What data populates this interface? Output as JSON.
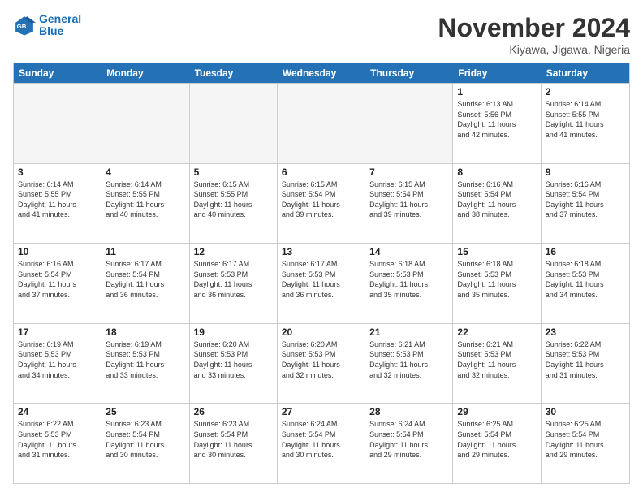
{
  "logo": {
    "line1": "General",
    "line2": "Blue"
  },
  "title": "November 2024",
  "location": "Kiyawa, Jigawa, Nigeria",
  "headers": [
    "Sunday",
    "Monday",
    "Tuesday",
    "Wednesday",
    "Thursday",
    "Friday",
    "Saturday"
  ],
  "weeks": [
    [
      {
        "day": "",
        "info": "",
        "empty": true
      },
      {
        "day": "",
        "info": "",
        "empty": true
      },
      {
        "day": "",
        "info": "",
        "empty": true
      },
      {
        "day": "",
        "info": "",
        "empty": true
      },
      {
        "day": "",
        "info": "",
        "empty": true
      },
      {
        "day": "1",
        "info": "Sunrise: 6:13 AM\nSunset: 5:56 PM\nDaylight: 11 hours\nand 42 minutes.",
        "empty": false
      },
      {
        "day": "2",
        "info": "Sunrise: 6:14 AM\nSunset: 5:55 PM\nDaylight: 11 hours\nand 41 minutes.",
        "empty": false
      }
    ],
    [
      {
        "day": "3",
        "info": "Sunrise: 6:14 AM\nSunset: 5:55 PM\nDaylight: 11 hours\nand 41 minutes.",
        "empty": false
      },
      {
        "day": "4",
        "info": "Sunrise: 6:14 AM\nSunset: 5:55 PM\nDaylight: 11 hours\nand 40 minutes.",
        "empty": false
      },
      {
        "day": "5",
        "info": "Sunrise: 6:15 AM\nSunset: 5:55 PM\nDaylight: 11 hours\nand 40 minutes.",
        "empty": false
      },
      {
        "day": "6",
        "info": "Sunrise: 6:15 AM\nSunset: 5:54 PM\nDaylight: 11 hours\nand 39 minutes.",
        "empty": false
      },
      {
        "day": "7",
        "info": "Sunrise: 6:15 AM\nSunset: 5:54 PM\nDaylight: 11 hours\nand 39 minutes.",
        "empty": false
      },
      {
        "day": "8",
        "info": "Sunrise: 6:16 AM\nSunset: 5:54 PM\nDaylight: 11 hours\nand 38 minutes.",
        "empty": false
      },
      {
        "day": "9",
        "info": "Sunrise: 6:16 AM\nSunset: 5:54 PM\nDaylight: 11 hours\nand 37 minutes.",
        "empty": false
      }
    ],
    [
      {
        "day": "10",
        "info": "Sunrise: 6:16 AM\nSunset: 5:54 PM\nDaylight: 11 hours\nand 37 minutes.",
        "empty": false
      },
      {
        "day": "11",
        "info": "Sunrise: 6:17 AM\nSunset: 5:54 PM\nDaylight: 11 hours\nand 36 minutes.",
        "empty": false
      },
      {
        "day": "12",
        "info": "Sunrise: 6:17 AM\nSunset: 5:53 PM\nDaylight: 11 hours\nand 36 minutes.",
        "empty": false
      },
      {
        "day": "13",
        "info": "Sunrise: 6:17 AM\nSunset: 5:53 PM\nDaylight: 11 hours\nand 36 minutes.",
        "empty": false
      },
      {
        "day": "14",
        "info": "Sunrise: 6:18 AM\nSunset: 5:53 PM\nDaylight: 11 hours\nand 35 minutes.",
        "empty": false
      },
      {
        "day": "15",
        "info": "Sunrise: 6:18 AM\nSunset: 5:53 PM\nDaylight: 11 hours\nand 35 minutes.",
        "empty": false
      },
      {
        "day": "16",
        "info": "Sunrise: 6:18 AM\nSunset: 5:53 PM\nDaylight: 11 hours\nand 34 minutes.",
        "empty": false
      }
    ],
    [
      {
        "day": "17",
        "info": "Sunrise: 6:19 AM\nSunset: 5:53 PM\nDaylight: 11 hours\nand 34 minutes.",
        "empty": false
      },
      {
        "day": "18",
        "info": "Sunrise: 6:19 AM\nSunset: 5:53 PM\nDaylight: 11 hours\nand 33 minutes.",
        "empty": false
      },
      {
        "day": "19",
        "info": "Sunrise: 6:20 AM\nSunset: 5:53 PM\nDaylight: 11 hours\nand 33 minutes.",
        "empty": false
      },
      {
        "day": "20",
        "info": "Sunrise: 6:20 AM\nSunset: 5:53 PM\nDaylight: 11 hours\nand 32 minutes.",
        "empty": false
      },
      {
        "day": "21",
        "info": "Sunrise: 6:21 AM\nSunset: 5:53 PM\nDaylight: 11 hours\nand 32 minutes.",
        "empty": false
      },
      {
        "day": "22",
        "info": "Sunrise: 6:21 AM\nSunset: 5:53 PM\nDaylight: 11 hours\nand 32 minutes.",
        "empty": false
      },
      {
        "day": "23",
        "info": "Sunrise: 6:22 AM\nSunset: 5:53 PM\nDaylight: 11 hours\nand 31 minutes.",
        "empty": false
      }
    ],
    [
      {
        "day": "24",
        "info": "Sunrise: 6:22 AM\nSunset: 5:53 PM\nDaylight: 11 hours\nand 31 minutes.",
        "empty": false
      },
      {
        "day": "25",
        "info": "Sunrise: 6:23 AM\nSunset: 5:54 PM\nDaylight: 11 hours\nand 30 minutes.",
        "empty": false
      },
      {
        "day": "26",
        "info": "Sunrise: 6:23 AM\nSunset: 5:54 PM\nDaylight: 11 hours\nand 30 minutes.",
        "empty": false
      },
      {
        "day": "27",
        "info": "Sunrise: 6:24 AM\nSunset: 5:54 PM\nDaylight: 11 hours\nand 30 minutes.",
        "empty": false
      },
      {
        "day": "28",
        "info": "Sunrise: 6:24 AM\nSunset: 5:54 PM\nDaylight: 11 hours\nand 29 minutes.",
        "empty": false
      },
      {
        "day": "29",
        "info": "Sunrise: 6:25 AM\nSunset: 5:54 PM\nDaylight: 11 hours\nand 29 minutes.",
        "empty": false
      },
      {
        "day": "30",
        "info": "Sunrise: 6:25 AM\nSunset: 5:54 PM\nDaylight: 11 hours\nand 29 minutes.",
        "empty": false
      }
    ]
  ]
}
